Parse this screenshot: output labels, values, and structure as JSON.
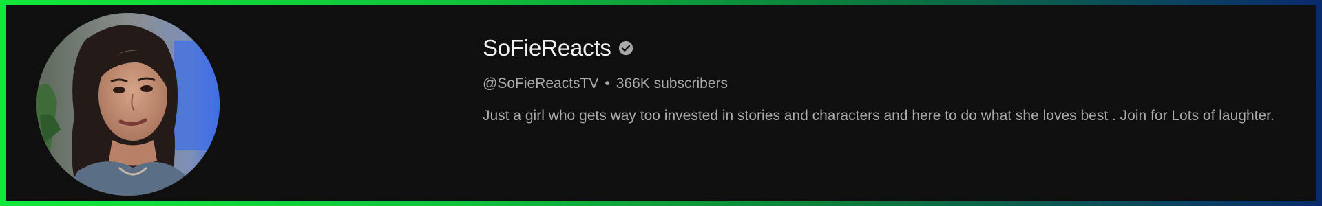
{
  "channel": {
    "name": "SoFieReacts",
    "verified_icon": "verified-check-icon",
    "handle": "@SoFieReactsTV",
    "separator": "•",
    "subscribers": "366K subscribers",
    "description": "Just a girl who gets way too invested in stories and characters and here to do what she loves best . Join for Lots of laughter."
  },
  "colors": {
    "background": "#0f0f0f",
    "name_text": "#f1f1f1",
    "secondary_text": "#aaaaaa",
    "border_gradient_start": "#12e83a",
    "border_gradient_end": "#0a2a6e"
  }
}
